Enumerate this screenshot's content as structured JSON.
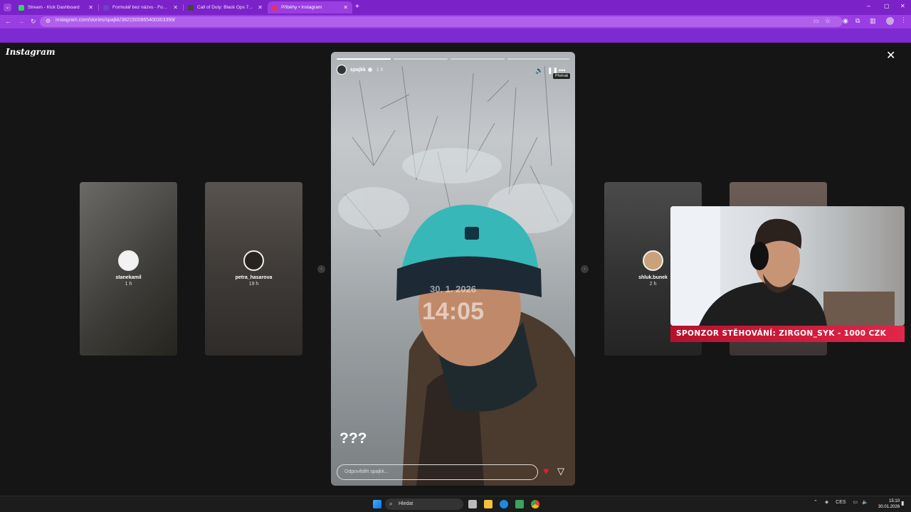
{
  "browser": {
    "tabs": [
      {
        "label": "Stream - Kick Dashboard",
        "favicon_color": "#2bd95b",
        "active": false
      },
      {
        "label": "Formulář bez názvu - Formulář",
        "favicon_color": "#6f42c1",
        "active": false
      },
      {
        "label": "Call of Duty: Black Ops 7 and C",
        "favicon_color": "#444444",
        "active": false
      },
      {
        "label": "Příběhy • Instagram",
        "favicon_color": "#e1306c",
        "active": true
      }
    ],
    "url": "instagram.com/stories/spajkk/3821500865400303399/"
  },
  "instagram": {
    "logo": "Instagram",
    "close_icon": "✕",
    "story": {
      "username": "spajkk",
      "time_ago": "1 h",
      "tooltip": "Přehrát",
      "date_overlay": "30. 1. 2026",
      "time_overlay": "14:05",
      "caption": "???",
      "reply_placeholder": "Odpovědět spajkk...",
      "progress_segments": 4
    },
    "side_stories": [
      {
        "username": "stanekamil",
        "time": "1 h"
      },
      {
        "username": "petra_hasarova",
        "time": "19 h"
      },
      {
        "username": "shluk.bunek",
        "time": "2 h"
      }
    ]
  },
  "stream_overlay": {
    "banner_text": "SPONZOR STĚHOVÁNÍ: ZIRGON_SYK - 1000 CZK"
  },
  "taskbar": {
    "search_placeholder": "Hledat",
    "language": "CES",
    "time": "15:10",
    "date": "30.01.2026"
  }
}
